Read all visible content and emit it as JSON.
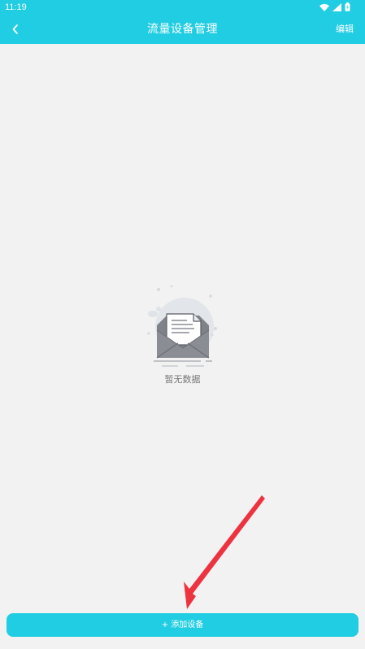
{
  "status": {
    "time": "11:19",
    "icons": [
      "wifi-icon",
      "signal-icon",
      "battery-icon"
    ]
  },
  "header": {
    "title": "流量设备管理",
    "edit_label": "编辑",
    "back_icon": "chevron-left-icon"
  },
  "empty": {
    "text": "暂无数据",
    "icon": "empty-envelope-icon"
  },
  "footer": {
    "add_label": "+ 添加设备"
  },
  "colors": {
    "accent": "#21cde2",
    "background": "#f2f2f2",
    "annotation_arrow": "#ee3340"
  }
}
